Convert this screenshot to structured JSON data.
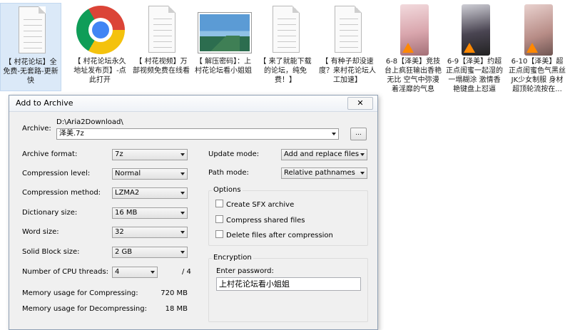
{
  "files": [
    {
      "type": "doc",
      "selected": true,
      "caption": "【 村花论坛】全免费-无套路-更新快"
    },
    {
      "type": "chrome",
      "selected": false,
      "caption": "【 村花论坛永久地址发布页】-点此打开"
    },
    {
      "type": "doc",
      "selected": false,
      "caption": "【 村花视频】万部视频免费在线看"
    },
    {
      "type": "photo",
      "selected": false,
      "caption": "【 解压密码】：上村花论坛看小姐姐"
    },
    {
      "type": "doc",
      "selected": false,
      "caption": "【 来了就能下载的论坛，纯免费！】"
    },
    {
      "type": "doc",
      "selected": false,
      "caption": "【 有种子却没速度？来村花论坛人工加速】"
    },
    {
      "type": "video",
      "selected": false,
      "caption": "6-8【泽美】竞技台上疯狂输出香艳无比 空气中弥漫着淫靡的气息"
    },
    {
      "type": "video",
      "selected": false,
      "caption": "6-9【泽美】约超正点闺蜜一起湿的一塌糊涂 激情香艳键盘上怼逼"
    },
    {
      "type": "video",
      "selected": false,
      "caption": "6-10【泽美】超正点闺蜜色气黑丝JK少女制服 身材超顶轮流按在..."
    }
  ],
  "dialog": {
    "title": "Add to Archive",
    "close_label": "✕",
    "archive": {
      "label": "Archive:",
      "path": "D:\\Aria2Download\\",
      "name": "泽美.7z",
      "browse_label": "..."
    },
    "left": {
      "format_label": "Archive format:",
      "format_value": "7z",
      "level_label": "Compression level:",
      "level_value": "Normal",
      "method_label": "Compression method:",
      "method_value": "LZMA2",
      "dict_label": "Dictionary size:",
      "dict_value": "16 MB",
      "word_label": "Word size:",
      "word_value": "32",
      "solid_label": "Solid Block size:",
      "solid_value": "2 GB",
      "threads_label": "Number of CPU threads:",
      "threads_value": "4",
      "threads_max": "/ 4",
      "mem_comp_label": "Memory usage for Compressing:",
      "mem_comp_value": "720 MB",
      "mem_decomp_label": "Memory usage for Decompressing:",
      "mem_decomp_value": "18 MB"
    },
    "right": {
      "update_label": "Update mode:",
      "update_value": "Add and replace files",
      "pathmode_label": "Path mode:",
      "pathmode_value": "Relative pathnames",
      "options_title": "Options",
      "opt_sfx": "Create SFX archive",
      "opt_shared": "Compress shared files",
      "opt_delete": "Delete files after compression",
      "encryption_title": "Encryption",
      "password_label": "Enter password:",
      "password_value": "上村花论坛看小姐姐"
    }
  }
}
